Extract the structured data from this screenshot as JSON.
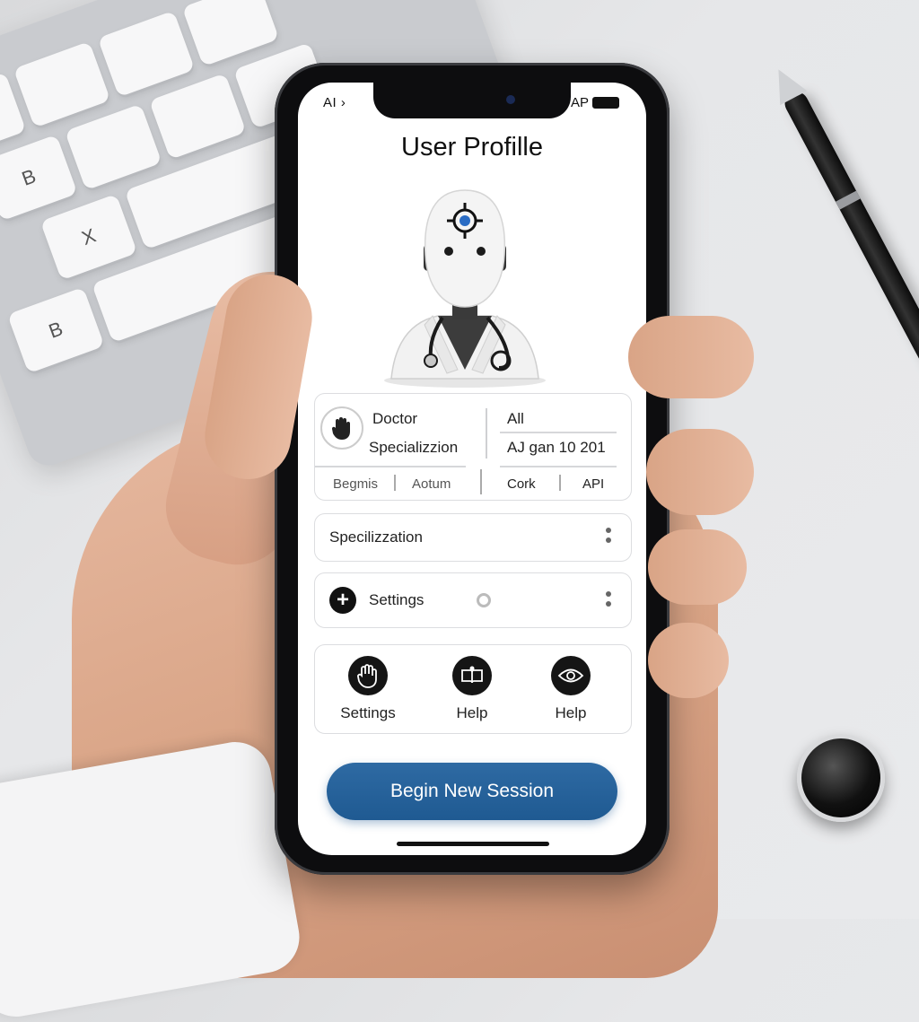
{
  "status_bar": {
    "left_text": "AI ›",
    "right_text": "AP"
  },
  "header": {
    "title": "User Profille"
  },
  "info_card": {
    "role": "Doctor",
    "specialization": "Specializzion",
    "right_top": "All",
    "right_date": "AJ gan 10 201",
    "bottom_left_a": "Begmis",
    "bottom_left_b": "Aotum",
    "bottom_right_a": "Cork",
    "bottom_right_b": "API"
  },
  "rows": {
    "specialization": {
      "label": "Specilizzation",
      "icon": "more-vertical-icon"
    },
    "settings": {
      "label": "Settings",
      "icon": "plus-circle-icon"
    }
  },
  "quick_actions": [
    {
      "label": "Settings",
      "icon": "hand-icon"
    },
    {
      "label": "Help",
      "icon": "book-icon"
    },
    {
      "label": "Help",
      "icon": "eye-icon"
    }
  ],
  "cta": {
    "label": "Begin New Session",
    "color": "#1f5a92"
  },
  "keyboard": {
    "keys": [
      "B",
      "X",
      "B"
    ]
  }
}
